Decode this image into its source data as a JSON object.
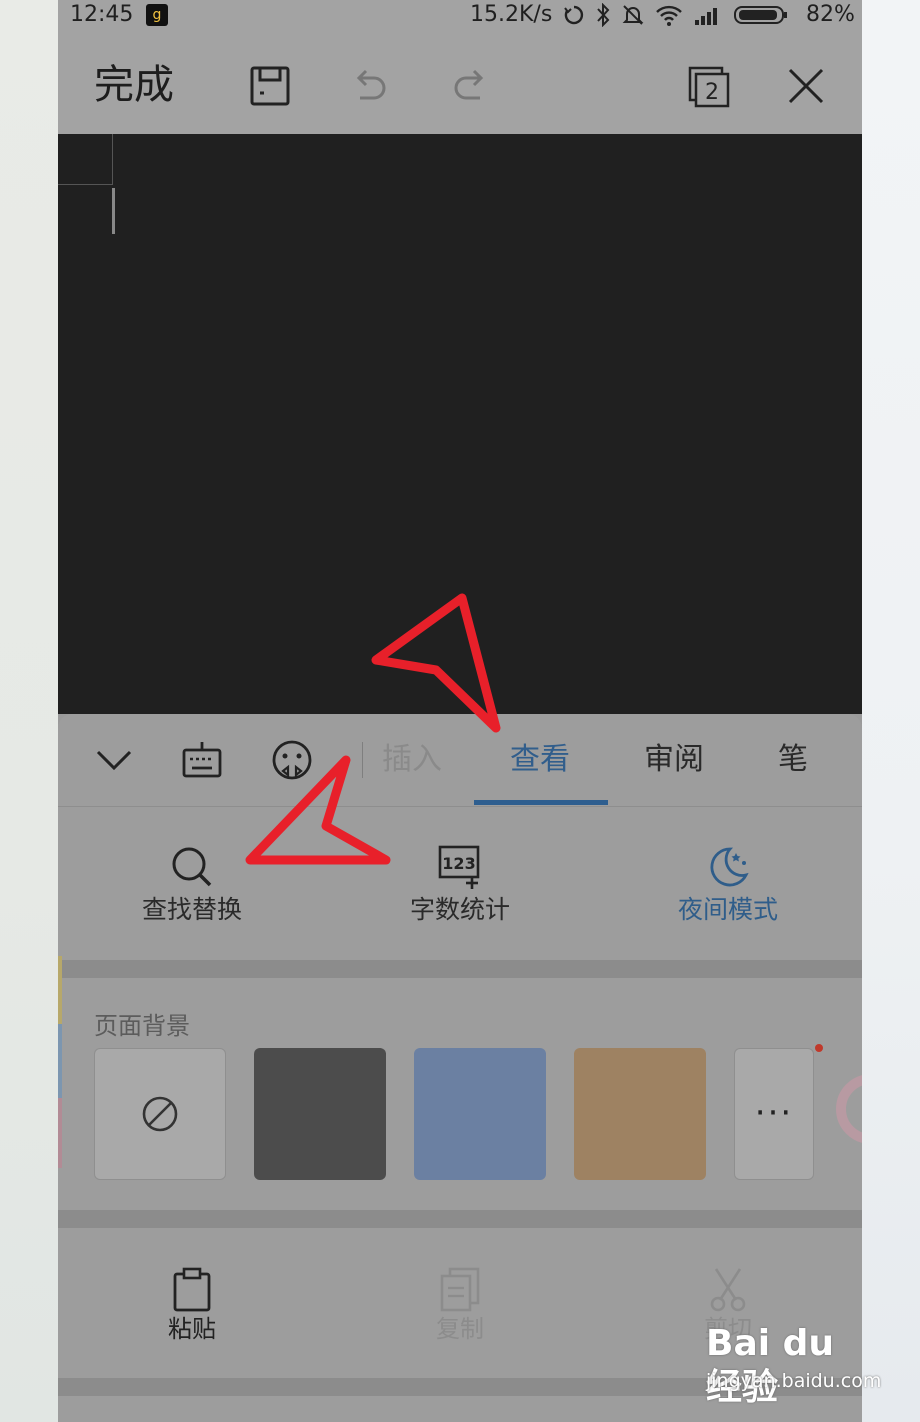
{
  "status_bar": {
    "time": "12:45",
    "net_speed": "15.2K/s",
    "battery": "82%",
    "icons": [
      "sync-icon",
      "bluetooth-icon",
      "mute-icon",
      "wifi-icon",
      "signal-icon",
      "battery-icon"
    ]
  },
  "toolbar": {
    "done_label": "完成",
    "icons": [
      "save-icon",
      "undo-icon",
      "redo-icon",
      "window-count-icon",
      "close-icon"
    ],
    "window_count": "2"
  },
  "panel": {
    "tabs": [
      {
        "label": "插入",
        "state": "faded"
      },
      {
        "label": "查看",
        "state": "active"
      },
      {
        "label": "审阅",
        "state": "normal"
      },
      {
        "label": "笔",
        "state": "normal"
      }
    ],
    "tools": [
      {
        "label": "查找替换",
        "icon": "search-icon"
      },
      {
        "label": "字数统计",
        "icon": "word-count-icon",
        "icon_text": "123"
      },
      {
        "label": "夜间模式",
        "icon": "moon-icon",
        "active": true
      }
    ],
    "page_background": {
      "title": "页面背景",
      "swatches": [
        {
          "name": "none",
          "color": "#a9a9a9"
        },
        {
          "name": "gray",
          "color": "#4c4c4c"
        },
        {
          "name": "blue",
          "color": "#6b80a2"
        },
        {
          "name": "tan",
          "color": "#9e8262"
        },
        {
          "name": "more",
          "symbol": "···"
        }
      ]
    },
    "clipboard": [
      {
        "label": "粘贴",
        "icon": "clipboard-icon",
        "enabled": true
      },
      {
        "label": "复制",
        "icon": "copy-icon",
        "enabled": false
      },
      {
        "label": "剪切",
        "icon": "scissors-icon",
        "enabled": false
      }
    ]
  },
  "watermark": {
    "logo": "Bai du 经验",
    "url": "jingyan.baidu.com"
  },
  "colors": {
    "accent": "#2e5e8f",
    "annotation_arrow": "#e8202a"
  }
}
